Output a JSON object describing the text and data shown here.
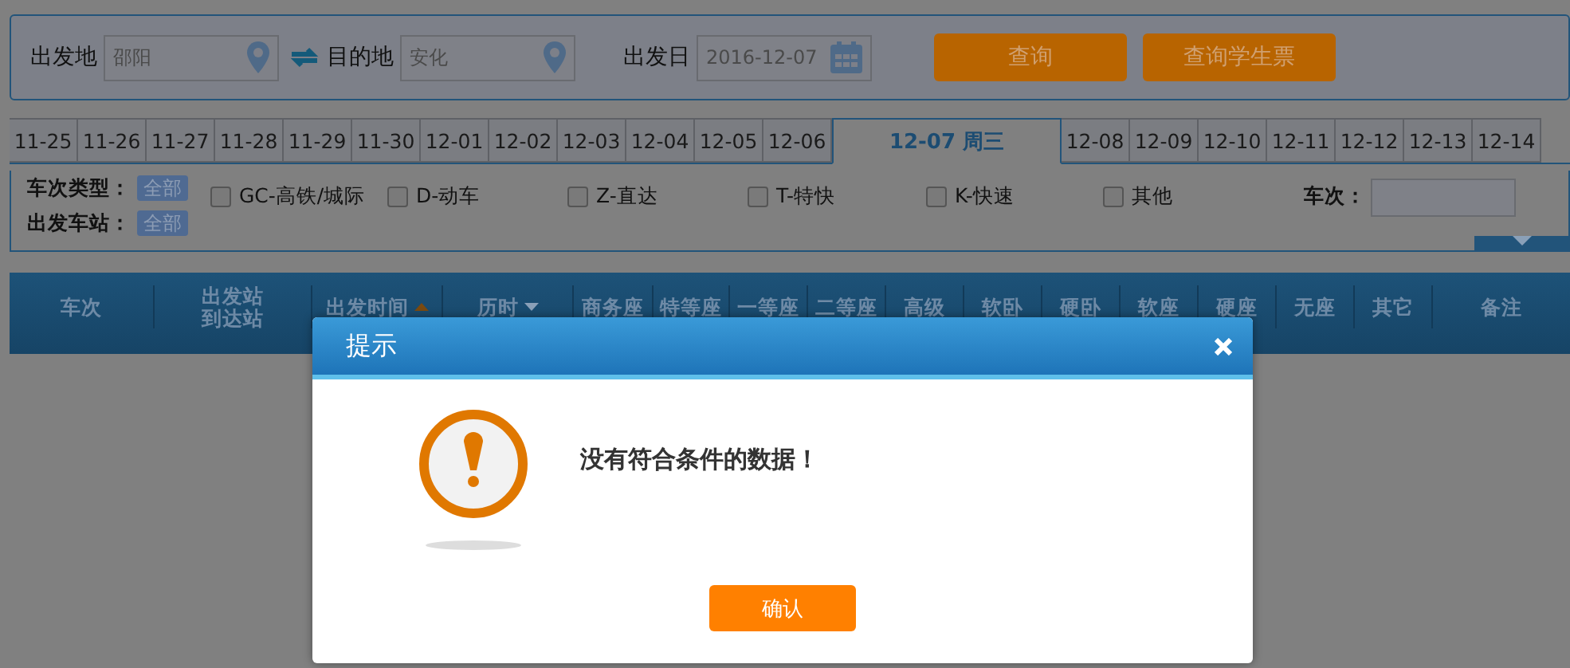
{
  "search": {
    "from": {
      "label": "出发地",
      "value": "邵阳"
    },
    "to": {
      "label": "目的地",
      "value": "安化"
    },
    "date": {
      "label": "出发日",
      "value": "2016-12-07"
    },
    "buttons": [
      "查询",
      "查询学生票"
    ]
  },
  "date_tabs": [
    {
      "label": "11-25",
      "selected": false
    },
    {
      "label": "11-26",
      "selected": false
    },
    {
      "label": "11-27",
      "selected": false
    },
    {
      "label": "11-28",
      "selected": false
    },
    {
      "label": "11-29",
      "selected": false
    },
    {
      "label": "11-30",
      "selected": false
    },
    {
      "label": "12-01",
      "selected": false
    },
    {
      "label": "12-02",
      "selected": false
    },
    {
      "label": "12-03",
      "selected": false
    },
    {
      "label": "12-04",
      "selected": false
    },
    {
      "label": "12-05",
      "selected": false
    },
    {
      "label": "12-06",
      "selected": false
    },
    {
      "label": "12-07 周三",
      "selected": true
    },
    {
      "label": "12-08",
      "selected": false
    },
    {
      "label": "12-09",
      "selected": false
    },
    {
      "label": "12-10",
      "selected": false
    },
    {
      "label": "12-11",
      "selected": false
    },
    {
      "label": "12-12",
      "selected": false
    },
    {
      "label": "12-13",
      "selected": false
    },
    {
      "label": "12-14",
      "selected": false
    }
  ],
  "filters": {
    "train_type": {
      "label": "车次类型：",
      "all": "全部",
      "options": [
        {
          "label": "GC-高铁/城际",
          "checked": false
        },
        {
          "label": "D-动车",
          "checked": false
        },
        {
          "label": "Z-直达",
          "checked": false
        },
        {
          "label": "T-特快",
          "checked": false
        },
        {
          "label": "K-快速",
          "checked": false
        },
        {
          "label": "其他",
          "checked": false
        }
      ]
    },
    "train_no": {
      "label": "车次："
    },
    "station": {
      "label": "出发车站：",
      "all": "全部"
    }
  },
  "table": {
    "columns": [
      {
        "label": "车次"
      },
      {
        "label": "出发站",
        "label_2": "到达站"
      },
      {
        "label": "出发时间",
        "sorted": true,
        "ascending": true
      },
      {
        "label": "历时",
        "sorted": true,
        "ascending": false
      },
      {
        "label": "商务座"
      },
      {
        "label": "特等座"
      },
      {
        "label": "一等座"
      },
      {
        "label": "二等座"
      },
      {
        "label": "高级"
      },
      {
        "label": "软卧"
      },
      {
        "label": "硬卧"
      },
      {
        "label": "软座"
      },
      {
        "label": "硬座"
      },
      {
        "label": "无座"
      },
      {
        "label": "其它"
      },
      {
        "label": "备注"
      }
    ]
  },
  "dialog": {
    "title": "提示",
    "message": "没有符合条件的数据！",
    "buttons": [
      "确认"
    ]
  }
}
